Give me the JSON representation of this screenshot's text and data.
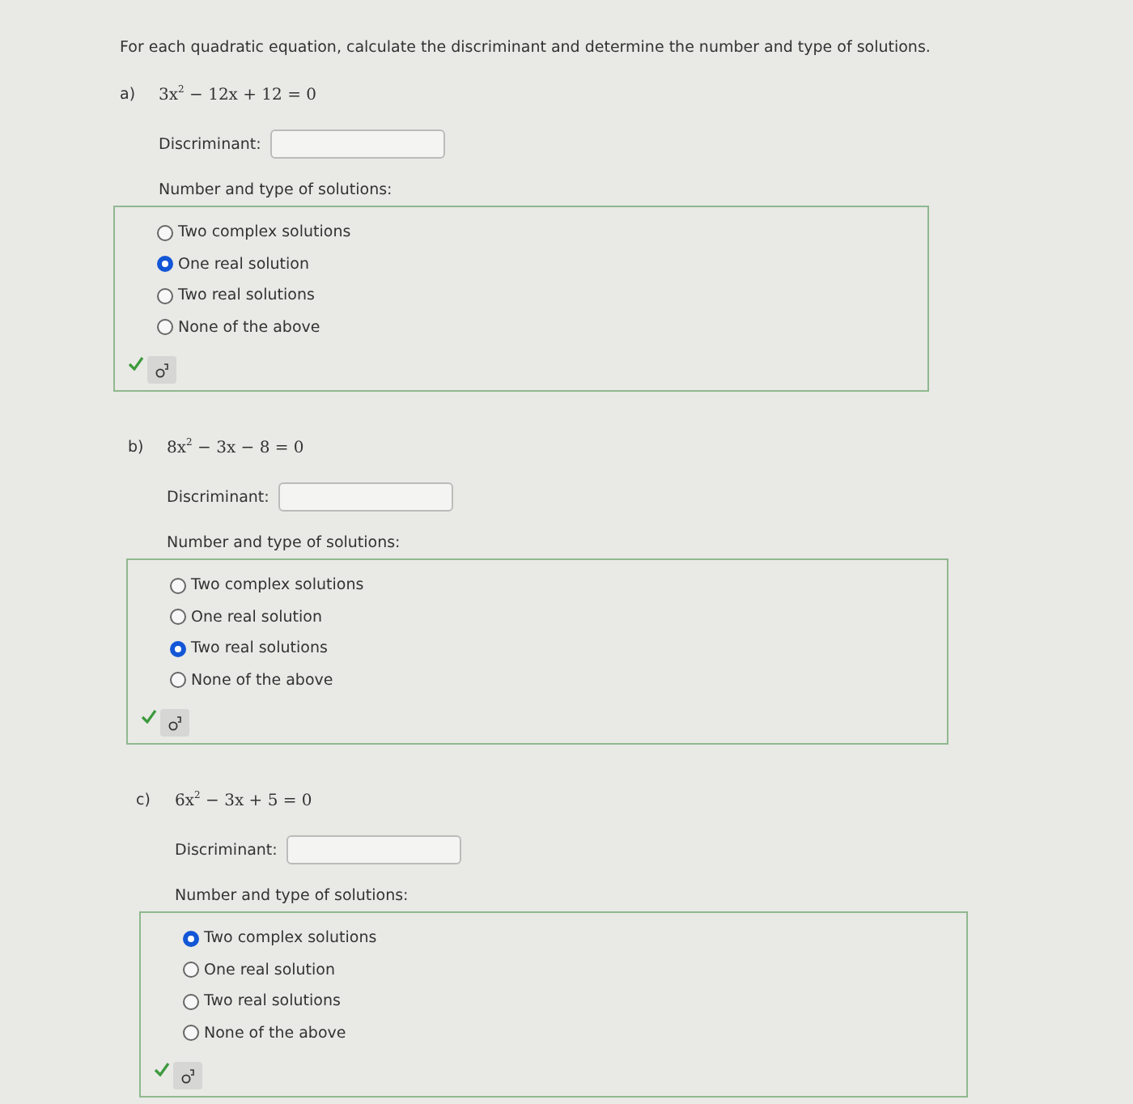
{
  "instructions": "For each quadratic equation, calculate the discriminant and determine the number and type of solutions.",
  "parts": [
    {
      "letter": "a)",
      "equation": "3x$^{2}$ − 12x + 12 = 0",
      "discriminant_label": "Discriminant:",
      "prompt": "Number and type of solutions:",
      "correct": true,
      "options": [
        {
          "label": "Two complex solutions",
          "selected": false
        },
        {
          "label": "One real solution",
          "selected": true
        },
        {
          "label": "Two real solutions",
          "selected": false
        },
        {
          "label": "None of the above",
          "selected": false
        }
      ]
    },
    {
      "letter": "b)",
      "equation": "8x$^{2}$ − 3x − 8 = 0",
      "discriminant_label": "Discriminant:",
      "prompt": "Number and type of solutions:",
      "correct": true,
      "options": [
        {
          "label": "Two complex solutions",
          "selected": false
        },
        {
          "label": "One real solution",
          "selected": false
        },
        {
          "label": "Two real solutions",
          "selected": true
        },
        {
          "label": "None of the above",
          "selected": false
        }
      ]
    },
    {
      "letter": "c)",
      "equation": "6x$^{2}$ − 3x + 5 = 0",
      "discriminant_label": "Discriminant:",
      "prompt": "Number and type of solutions:",
      "correct": true,
      "options": [
        {
          "label": "Two complex solutions",
          "selected": true
        },
        {
          "label": "One real solution",
          "selected": false
        },
        {
          "label": "Two real solutions",
          "selected": false
        },
        {
          "label": "None of the above",
          "selected": false
        }
      ]
    }
  ]
}
